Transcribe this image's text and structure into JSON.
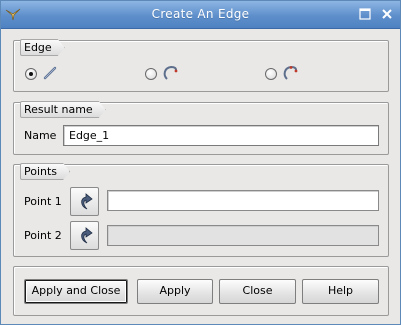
{
  "window": {
    "title": "Create An Edge",
    "icons": {
      "app": "salome-app-icon",
      "maximize": "maximize-icon",
      "close": "close-icon"
    }
  },
  "edge_group": {
    "label": "Edge",
    "options": [
      {
        "icon": "line-segment-icon",
        "selected": true
      },
      {
        "icon": "arc-icon",
        "selected": false
      },
      {
        "icon": "arc-reverse-icon",
        "selected": false
      }
    ]
  },
  "result_group": {
    "label": "Result name",
    "name_label": "Name",
    "name_value": "Edge_1"
  },
  "points_group": {
    "label": "Points",
    "point1_label": "Point 1",
    "point1_value": "",
    "point2_label": "Point 2",
    "point2_value": "",
    "select_icon": "select-arrow-icon"
  },
  "buttons": {
    "apply_close": "Apply and Close",
    "apply": "Apply",
    "close": "Close",
    "help": "Help"
  },
  "colors": {
    "titlebar": "#5e8fcb",
    "window_bg": "#e9e8e7",
    "point1_field_bg": "#ffffff",
    "point2_field_bg": "#e2e2e2"
  }
}
